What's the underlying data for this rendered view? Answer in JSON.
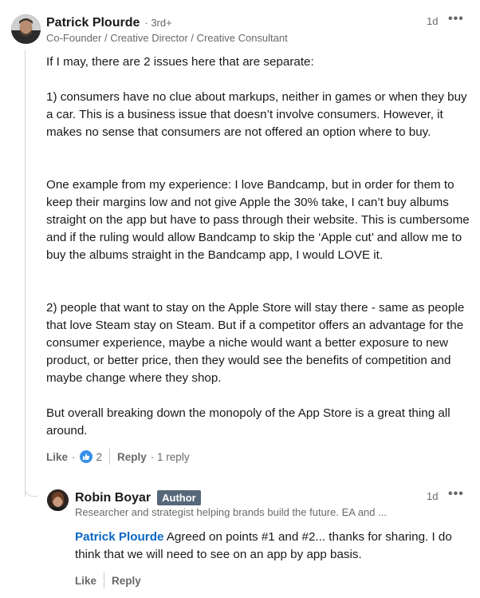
{
  "comment": {
    "author": "Patrick Plourde",
    "degree": "· 3rd+",
    "headline": "Co-Founder / Creative Director / Creative Consultant",
    "time": "1d",
    "more": "•••",
    "paragraphs": [
      "If I may, there are 2 issues here that are separate:",
      "1) consumers have no clue about markups, neither in games or when they buy a car. This is a business issue that doesn’t involve consumers. However, it makes no sense that consumers are not offered an option where to buy.",
      "One example from my experience: I love Bandcamp, but in order for them to keep their margins low and not give Apple the 30% take, I can’t buy albums straight on the app but have to pass through their website. This is cumbersome and if the ruling would allow Bandcamp to skip the ‘Apple cut’ and allow me to buy the albums straight in the Bandcamp app, I would LOVE it.",
      "2) people that want to stay on the Apple Store will stay there - same as people that love Steam stay on Steam. But if a competitor offers an advantage for the consumer experience, maybe a niche would want a better exposure to new product, or better price, then they would see the benefits of competition and maybe change where they shop.",
      "But overall breaking down the monopoly of the App Store is a great thing all around."
    ],
    "actions": {
      "like": "Like",
      "dot": "·",
      "reaction_count": "2",
      "reply": "Reply",
      "reply_count": "· 1 reply"
    }
  },
  "reply": {
    "author": "Robin Boyar",
    "badge": "Author",
    "headline": "Researcher and strategist helping brands build the future. EA and ...",
    "time": "1d",
    "more": "•••",
    "mention": "Patrick Plourde",
    "text": " Agreed on points #1 and #2... thanks for sharing. I do think that we will need to see on an app by app basis.",
    "actions": {
      "like": "Like",
      "reply": "Reply"
    }
  },
  "colors": {
    "link": "#0a66c2",
    "like_icon": "#378fe9",
    "badge": "#56687a"
  }
}
